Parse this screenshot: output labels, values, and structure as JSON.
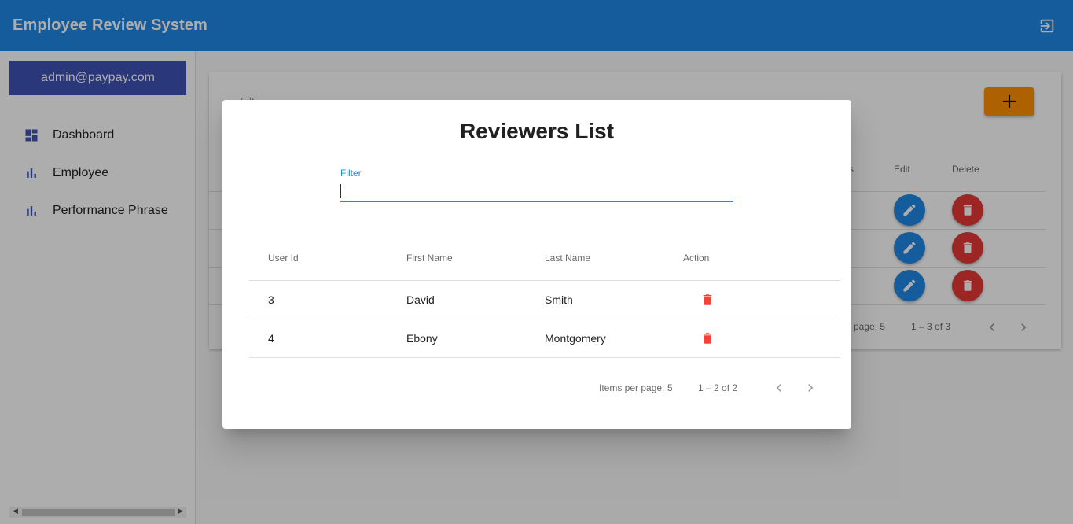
{
  "app": {
    "title": "Employee Review System"
  },
  "colors": {
    "primary": "#1e88e5",
    "accent": "#3f51b5",
    "warn": "#e53935",
    "add": "#ff8f00"
  },
  "sidebar": {
    "user_email": "admin@paypay.com",
    "items": [
      {
        "label": "Dashboard",
        "icon": "dashboard-icon"
      },
      {
        "label": "Employee",
        "icon": "bar-chart-icon"
      },
      {
        "label": "Performance Phrase",
        "icon": "bar-chart-icon"
      }
    ]
  },
  "background_page": {
    "filter_label": "Filt",
    "columns": [
      "s",
      "Edit",
      "Delete"
    ],
    "row_count": 3,
    "pager": {
      "items_per_page": "page: 5",
      "range": "1 – 3 of 3"
    }
  },
  "dialog": {
    "title": "Reviewers List",
    "filter": {
      "label": "Filter",
      "value": ""
    },
    "columns": [
      "User Id",
      "First Name",
      "Last Name",
      "Action"
    ],
    "rows": [
      {
        "user_id": "3",
        "first_name": "David",
        "last_name": "Smith"
      },
      {
        "user_id": "4",
        "first_name": "Ebony",
        "last_name": "Montgomery"
      }
    ],
    "pager": {
      "items_per_page_label": "Items per page:",
      "items_per_page_value": "5",
      "range": "1 – 2 of 2"
    }
  }
}
